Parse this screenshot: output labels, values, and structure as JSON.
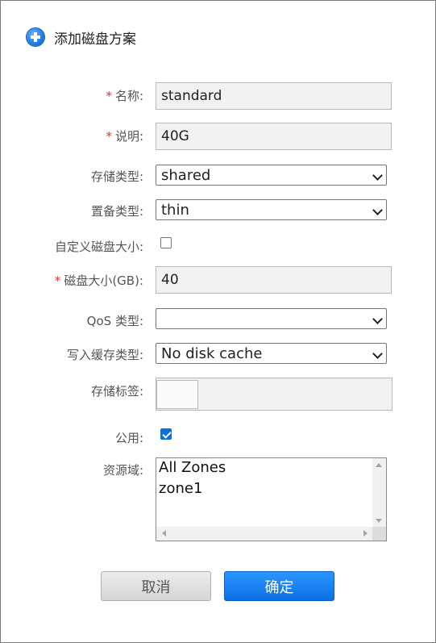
{
  "dialog": {
    "title": "添加磁盘方案",
    "required_mark": "*"
  },
  "form": {
    "name": {
      "label": "名称:",
      "value": "standard",
      "required": true
    },
    "description": {
      "label": "说明:",
      "value": "40G",
      "required": true
    },
    "storage_type": {
      "label": "存储类型:",
      "value": "shared"
    },
    "provision_type": {
      "label": "置备类型:",
      "value": "thin"
    },
    "custom_size": {
      "label": "自定义磁盘大小:",
      "checked": false
    },
    "disk_size": {
      "label": "磁盘大小(GB):",
      "value": "40",
      "required": true
    },
    "qos_type": {
      "label": "QoS 类型:",
      "value": ""
    },
    "write_cache": {
      "label": "写入缓存类型:",
      "value": "No disk cache"
    },
    "storage_tags": {
      "label": "存储标签:"
    },
    "public": {
      "label": "公用:",
      "checked": true
    },
    "zones": {
      "label": "资源域:",
      "options": [
        "All Zones",
        "zone1"
      ]
    }
  },
  "buttons": {
    "cancel": "取消",
    "ok": "确定"
  },
  "colors": {
    "accent": "#0a6fe5",
    "required": "#e0352b",
    "input_bg": "#f2f2f2"
  }
}
